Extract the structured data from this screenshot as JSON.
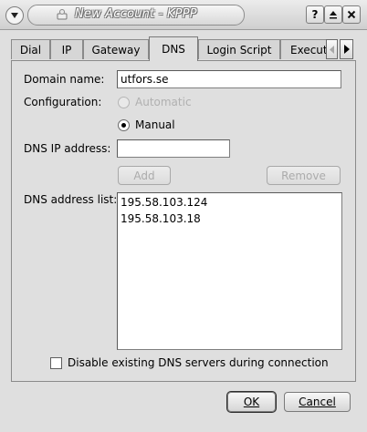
{
  "window": {
    "title": "New Account - KPPP",
    "buttons": {
      "help": "?",
      "shade": "⏏",
      "close": "×"
    }
  },
  "tabs": [
    {
      "label": "Dial"
    },
    {
      "label": "IP"
    },
    {
      "label": "Gateway"
    },
    {
      "label": "DNS",
      "active": true
    },
    {
      "label": "Login Script"
    },
    {
      "label": "Execut"
    }
  ],
  "dns": {
    "domain_name_label": "Domain name:",
    "domain_name_value": "utfors.se",
    "configuration_label": "Configuration:",
    "option_automatic": "Automatic",
    "option_manual": "Manual",
    "selected": "Manual",
    "dns_ip_label": "DNS IP address:",
    "dns_ip_value": "",
    "add_button": "Add",
    "remove_button": "Remove",
    "address_list_label": "DNS address list:",
    "addresses": [
      "195.58.103.124",
      "195.58.103.18"
    ],
    "disable_checkbox_label": "Disable existing DNS servers during connection",
    "disable_checked": false
  },
  "footer": {
    "ok_label": "OK",
    "cancel_label": "Cancel"
  }
}
